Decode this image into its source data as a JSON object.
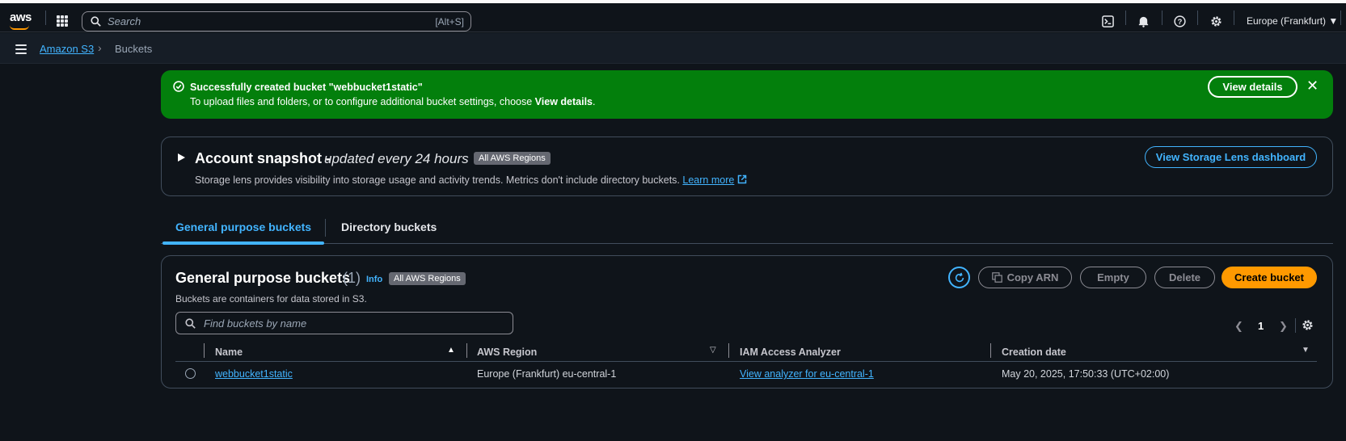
{
  "topnav": {
    "logo": "aws",
    "search_placeholder": "Search",
    "search_shortcut": "[Alt+S]",
    "region": "Europe (Frankfurt)"
  },
  "breadcrumb": {
    "root": "Amazon S3",
    "current": "Buckets"
  },
  "flash": {
    "title": "Successfully created bucket \"webbucket1static\"",
    "body_prefix": "To upload files and folders, or to configure additional bucket settings, choose ",
    "body_bold": "View details",
    "body_suffix": ".",
    "button": "View details",
    "color": "#037f0c"
  },
  "snapshot": {
    "title": "Account snapshot -",
    "subtitle": "updated every 24 hours",
    "badge": "All AWS Regions",
    "description": "Storage lens provides visibility into storage usage and activity trends. Metrics don't include directory buckets.",
    "learn_more": "Learn more",
    "button": "View Storage Lens dashboard"
  },
  "tabs": {
    "active": "General purpose buckets",
    "other": "Directory buckets"
  },
  "buckets_panel": {
    "title": "General purpose buckets",
    "count": "(1)",
    "info": "Info",
    "badge": "All AWS Regions",
    "description": "Buckets are containers for data stored in S3.",
    "buttons": {
      "copy_arn": "Copy ARN",
      "empty": "Empty",
      "delete": "Delete",
      "create": "Create bucket"
    },
    "filter_placeholder": "Find buckets by name",
    "page": "1",
    "columns": [
      "Name",
      "AWS Region",
      "IAM Access Analyzer",
      "Creation date"
    ],
    "rows": [
      {
        "name": "webbucket1static",
        "region": "Europe (Frankfurt) eu-central-1",
        "analyzer": "View analyzer for eu-central-1",
        "created": "May 20, 2025, 17:50:33 (UTC+02:00)"
      }
    ]
  },
  "colors": {
    "accent": "#42b4ff",
    "primary_button": "#ff9900",
    "background": "#0f141a"
  }
}
